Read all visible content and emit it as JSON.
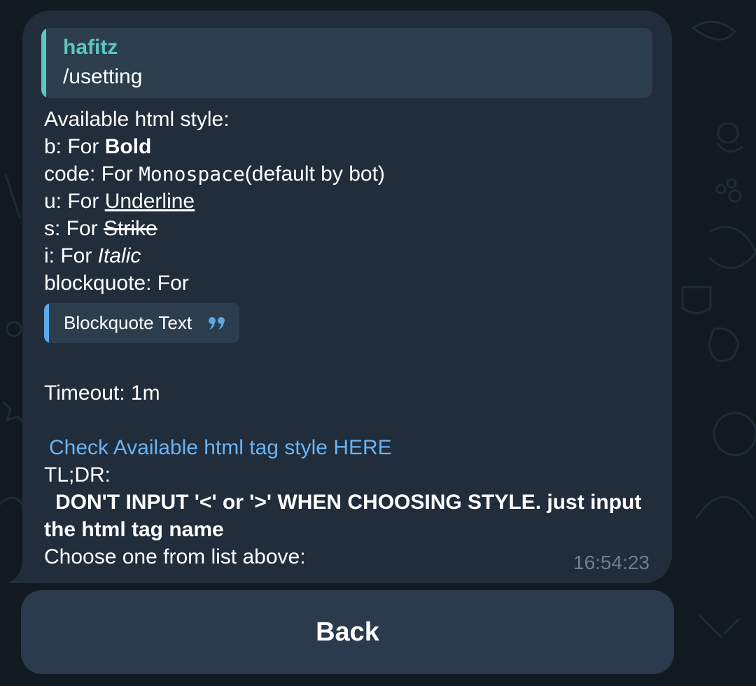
{
  "reply": {
    "author": "hafitz",
    "text": "/usetting"
  },
  "message": {
    "intro": "Available html style:",
    "b_prefix": "b: For ",
    "b_sample": "Bold",
    "code_prefix": "code: For ",
    "code_sample": "Monospace",
    "code_suffix": "(default by bot)",
    "u_prefix": "u: For ",
    "u_sample": "Underline",
    "s_prefix": "s: For ",
    "s_sample": "Strike",
    "i_prefix": "i: For ",
    "i_sample": "Italic",
    "blockquote_prefix": "blockquote: For",
    "blockquote_sample": "Blockquote Text",
    "timeout": "Timeout: 1m",
    "link_text": "Check Available html tag style HERE",
    "tldr_label": "TL;DR:",
    "warning": "DON'T INPUT '<' or '>' WHEN CHOOSING STYLE. just input the html tag name",
    "choose": "Choose one from list above:",
    "time": "16:54:23"
  },
  "keyboard": {
    "back_label": "Back"
  },
  "colors": {
    "background": "#121a21",
    "bubble": "#212d3b",
    "reply_accent": "#5cc7c2",
    "link": "#6ab3f3",
    "blockquote_accent": "#5ea8e6",
    "button": "#2b3b4d"
  }
}
